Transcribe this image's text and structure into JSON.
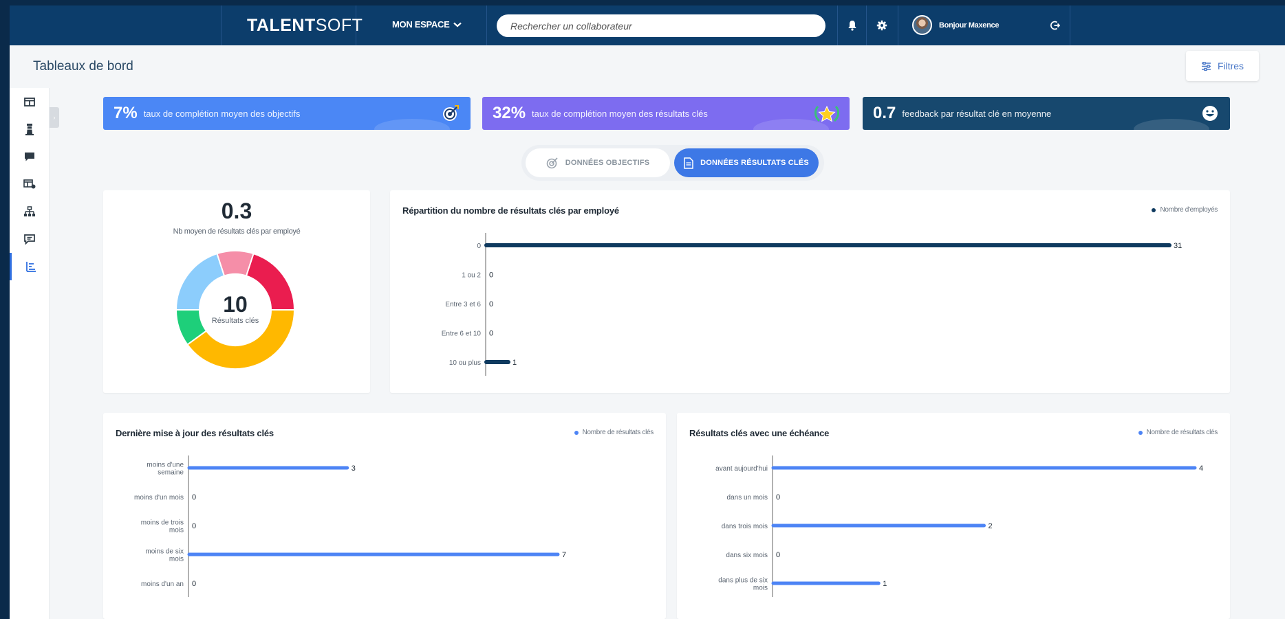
{
  "topbar": {
    "logo_bold": "TALENT",
    "logo_light": "SOFT",
    "espace_label": "MON ESPACE",
    "search_placeholder": "Rechercher un collaborateur",
    "user_greeting": "Bonjour Maxence"
  },
  "page": {
    "title": "Tableaux de bord",
    "filters_label": "Filtres"
  },
  "sidebar": {
    "items": [
      {
        "icon": "dashboard-icon"
      },
      {
        "icon": "lighthouse-icon"
      },
      {
        "icon": "chat-icon"
      },
      {
        "icon": "review-icon"
      },
      {
        "icon": "org-chart-icon"
      },
      {
        "icon": "feedback-icon"
      },
      {
        "icon": "reporting-icon",
        "active": true
      }
    ]
  },
  "kpis": [
    {
      "value": "7%",
      "label": "taux de complétion moyen des objectifs",
      "color": "#4b87f5",
      "icon": "target-icon"
    },
    {
      "value": "32%",
      "label": "taux de complétion moyen des résultats clés",
      "color": "#7d6cf0",
      "icon": "star-laurel-icon"
    },
    {
      "value": "0.7",
      "label": "feedback par résultat clé en moyenne",
      "color": "#17486e",
      "icon": "smiley-icon"
    }
  ],
  "toggle": {
    "objectives_label": "DONNÉES OBJECTIFS",
    "key_results_label": "DONNÉES RÉSULTATS CLÉS"
  },
  "summary_card": {
    "avg_value": "0.3",
    "avg_label": "Nb moyen de résultats clés par employé",
    "total_value": "10",
    "total_label": "Résultats clés"
  },
  "colors": {
    "navy": "#0c3d6b",
    "blue": "#4d84f5",
    "bar_dark": "#0f3a5f"
  },
  "chart_data": [
    {
      "type": "pie",
      "id": "donut",
      "values": [
        1,
        2,
        4,
        1,
        2
      ],
      "colors": [
        "#f58ea8",
        "#ea1d4f",
        "#ffb800",
        "#1ecf7a",
        "#8ccdfc"
      ],
      "labels": []
    },
    {
      "type": "bar",
      "id": "distribution",
      "title": "Répartition du nombre de résultats clés par employé",
      "categories": [
        "0",
        "1 ou 2",
        "Entre 3 et 6",
        "Entre 6 et 10",
        "10 ou plus"
      ],
      "series": [
        {
          "name": "Nombre d'employés",
          "values": [
            31,
            0,
            0,
            0,
            1
          ]
        }
      ],
      "color": "#0f3a5f"
    },
    {
      "type": "bar",
      "id": "last_update",
      "title": "Dernière mise à jour des résultats clés",
      "categories": [
        [
          "moins d'une",
          "semaine"
        ],
        [
          "moins d'un mois"
        ],
        [
          "moins de trois",
          "mois"
        ],
        [
          "moins de six",
          "mois"
        ],
        [
          "moins d'un an"
        ]
      ],
      "series": [
        {
          "name": "Nombre de résultats clés",
          "values": [
            3,
            0,
            0,
            7,
            0
          ]
        }
      ],
      "color": "#4d84f5"
    },
    {
      "type": "bar",
      "id": "deadline",
      "title": "Résultats clés avec une échéance",
      "categories": [
        [
          "avant aujourd'hui"
        ],
        [
          "dans un mois"
        ],
        [
          "dans trois mois"
        ],
        [
          "dans six mois"
        ],
        [
          "dans plus de six",
          "mois"
        ]
      ],
      "series": [
        {
          "name": "Nombre de résultats clés",
          "values": [
            4,
            0,
            2,
            0,
            1
          ]
        }
      ],
      "color": "#4d84f5"
    }
  ]
}
